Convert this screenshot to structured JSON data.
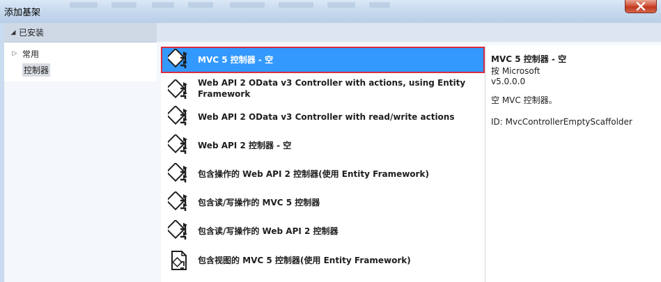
{
  "window": {
    "title": "添加基架"
  },
  "sidebar": {
    "installed_label": "已安装",
    "items": [
      {
        "label": "常用"
      },
      {
        "label": "控制器"
      }
    ]
  },
  "templates": [
    {
      "label": "MVC 5 控制器 - 空",
      "icon": "mvc-controller-icon"
    },
    {
      "label": "Web API 2 OData v3 Controller with actions, using Entity Framework",
      "icon": "mvc-controller-icon"
    },
    {
      "label": "Web API 2 OData v3 Controller with read/write actions",
      "icon": "mvc-controller-icon"
    },
    {
      "label": "Web API 2 控制器 - 空",
      "icon": "mvc-controller-icon"
    },
    {
      "label": "包含操作的 Web API 2 控制器(使用 Entity Framework)",
      "icon": "mvc-controller-icon"
    },
    {
      "label": "包含读/写操作的 MVC 5 控制器",
      "icon": "mvc-controller-icon"
    },
    {
      "label": "包含读/写操作的 Web API 2 控制器",
      "icon": "mvc-controller-icon"
    },
    {
      "label": "包含视图的 MVC 5 控制器(使用 Entity Framework)",
      "icon": "mvc-controller-views-icon"
    }
  ],
  "details": {
    "title": "MVC 5 控制器 - 空",
    "author": "按 Microsoft",
    "version": "v5.0.0.0",
    "description": "空 MVC 控制器。",
    "id": "ID: MvcControllerEmptyScaffolder"
  },
  "colors": {
    "selection": "#3399ff",
    "selection_border": "#d92b3c"
  }
}
